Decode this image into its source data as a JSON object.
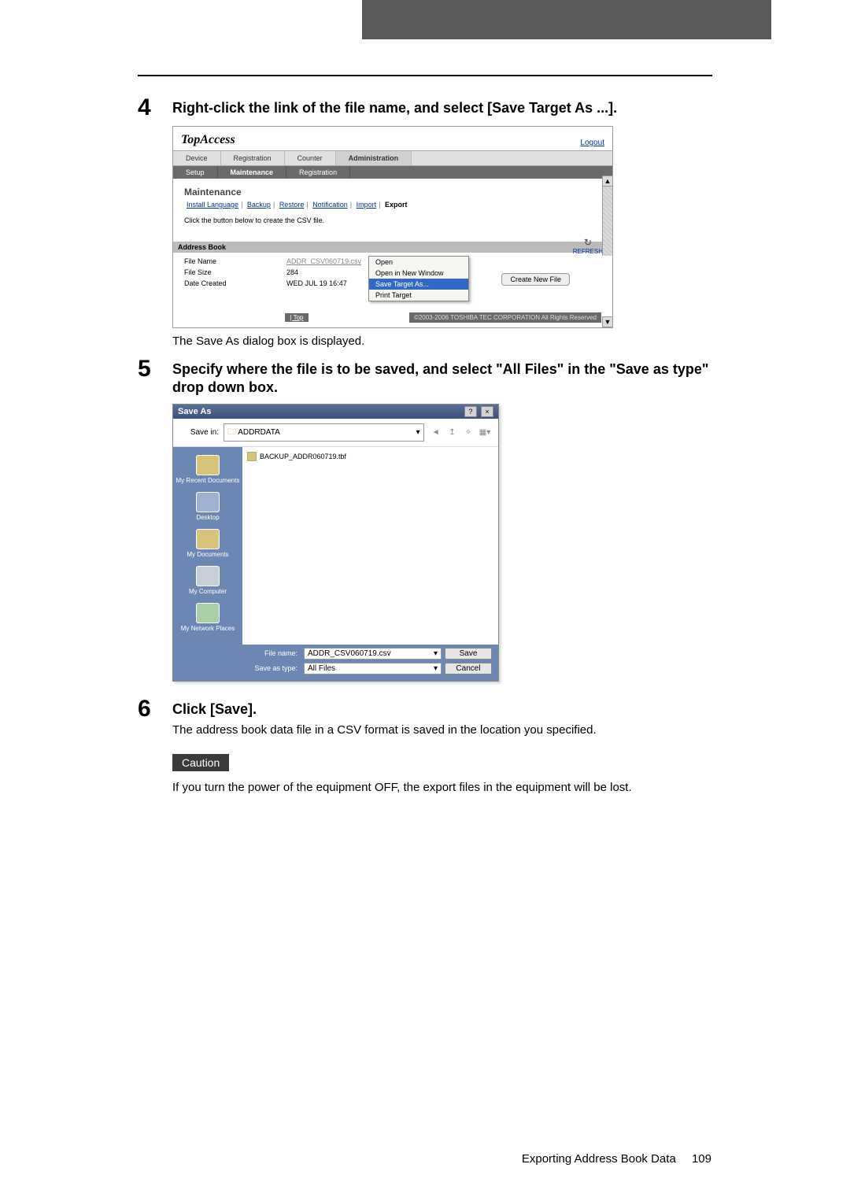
{
  "steps": {
    "s4": {
      "num": "4",
      "title": "Right-click the link of the file name, and select [Save Target As ...].",
      "after": "The Save As dialog box is displayed."
    },
    "s5": {
      "num": "5",
      "title": "Specify where the file is to be saved, and select \"All Files\" in the \"Save as type\" drop down box."
    },
    "s6": {
      "num": "6",
      "title": "Click [Save].",
      "body": "The address book data file in a CSV format is saved in the location you specified."
    }
  },
  "topaccess": {
    "brand": "TopAccess",
    "logout": "Logout",
    "tabs": {
      "device": "Device",
      "registration": "Registration",
      "counter": "Counter",
      "administration": "Administration"
    },
    "subtabs": {
      "setup": "Setup",
      "maintenance": "Maintenance",
      "registration": "Registration"
    },
    "heading": "Maintenance",
    "links": {
      "install_language": "Install Language",
      "backup": "Backup",
      "restore": "Restore",
      "notification": "Notification",
      "import": "Import",
      "export": "Export"
    },
    "msg": "Click the button below to create the CSV file.",
    "refresh": "REFRESH",
    "section": "Address Book",
    "rows": {
      "filename_lbl": "File Name",
      "filename_val": "ADDR_CSV060719.csv",
      "filesize_lbl": "File Size",
      "filesize_val": "284",
      "date_lbl": "Date Created",
      "date_val": "WED JUL 19 16:47"
    },
    "context_menu": {
      "open": "Open",
      "open_new": "Open in New Window",
      "save_target": "Save Target As...",
      "print_target": "Print Target"
    },
    "new_file_btn": "Create New File",
    "top_link": "Top",
    "copyright": "©2003-2006 TOSHIBA TEC CORPORATION All Rights Reserved"
  },
  "saveas": {
    "title": "Save As",
    "savein_lbl": "Save in:",
    "savein_val": "ADDRDATA",
    "existing_file": "BACKUP_ADDR060719.tbf",
    "places": {
      "recent": "My Recent Documents",
      "desktop": "Desktop",
      "mydocs": "My Documents",
      "mycomp": "My Computer",
      "mynet": "My Network Places"
    },
    "filename_lbl": "File name:",
    "filename_val": "ADDR_CSV060719.csv",
    "savetype_lbl": "Save as type:",
    "savetype_val": "All Files",
    "save_btn": "Save",
    "cancel_btn": "Cancel"
  },
  "caution": {
    "label": "Caution",
    "text": "If you turn the power of the equipment OFF, the export files in the equipment will be lost."
  },
  "footer": {
    "text": "Exporting Address Book Data",
    "page": "109"
  }
}
